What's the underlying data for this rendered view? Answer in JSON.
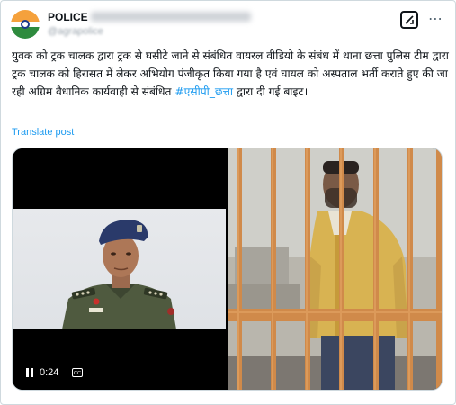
{
  "author": {
    "name": "POLICE",
    "handle": "@agrapolice"
  },
  "post": {
    "text_main": "युवक को ट्रक चालक द्वारा ट्रक से घसीटे जाने से संबंधित वायरल वीडियो के संबंध में थाना छत्ता पुलिस टीम द्वारा ट्रक चालक को हिरासत में लेकर अभियोग पंजीकृत किया गया है एवं घायल को अस्पताल भर्ती कराते हुए की जा रही अग्रिम वैधानिक कार्यवाही से संबंधित ",
    "hashtag": "#एसीपी_छत्ता",
    "text_end": " द्वारा दी गई बाइट।",
    "translate_label": "Translate post"
  },
  "video": {
    "time": "0:24",
    "cc_label": "CC"
  },
  "icons": {
    "grok": "grok-icon",
    "more": "more-icon",
    "pause": "pause-icon",
    "captions": "closed-captions-icon"
  },
  "colors": {
    "link": "#1d9bf0",
    "text": "#0f1419",
    "secondary": "#536471",
    "border": "#cfd9de"
  }
}
